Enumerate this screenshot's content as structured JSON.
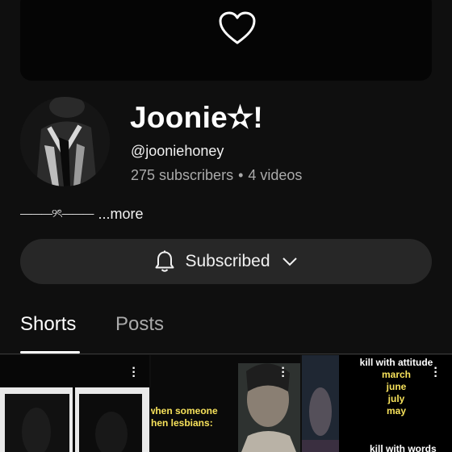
{
  "banner": {
    "icon": "heart-outline-icon"
  },
  "channel": {
    "name": "Joonie✫!",
    "handle": "@jooniehoney",
    "subscribers": "275 subscribers",
    "separator": "•",
    "videos": "4 videos",
    "description_decoration": "———୨ৎ———",
    "more_label": "...more"
  },
  "subscribe": {
    "icon": "bell-icon",
    "label": "Subscribed",
    "chevron": "chevron-down-icon"
  },
  "tabs": [
    {
      "label": "Shorts",
      "active": true
    },
    {
      "label": "Posts",
      "active": false
    }
  ],
  "shorts": [
    {
      "caption": ""
    },
    {
      "caption_lines": [
        "when someone",
        "then lesbians:"
      ]
    },
    {
      "caption_top": "kill with attitude",
      "caption_list": [
        "march",
        "june",
        "july",
        "may"
      ],
      "caption_bottom": "kill with words"
    }
  ],
  "colors": {
    "background": "#0f0f0f",
    "button": "#272727",
    "secondary_text": "#aaaaaa",
    "caption_yellow": "#f7e25b"
  }
}
